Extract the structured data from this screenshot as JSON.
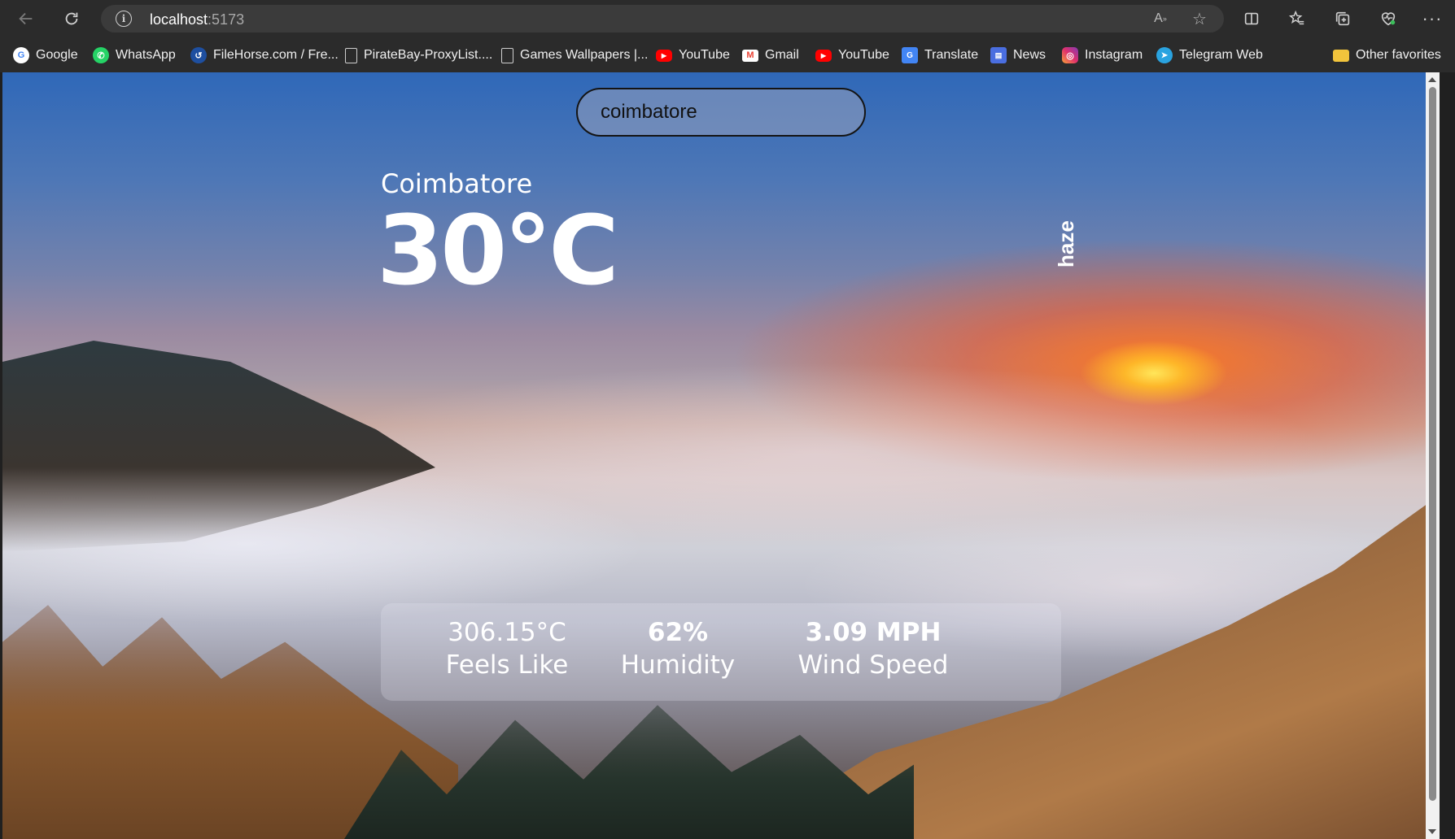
{
  "browser": {
    "url_host": "localhost",
    "url_port": ":5173",
    "bookmarks": [
      {
        "label": "Google",
        "icon": "google-icon",
        "color": "#4285f4"
      },
      {
        "label": "WhatsApp",
        "icon": "whatsapp-icon",
        "color": "#25d366"
      },
      {
        "label": "FileHorse.com / Fre...",
        "icon": "filehorse-icon",
        "color": "#1e88e5"
      },
      {
        "label": "PirateBay-ProxyList....",
        "icon": "page-icon",
        "color": "#cfcfcf"
      },
      {
        "label": "Games Wallpapers |...",
        "icon": "page-icon",
        "color": "#cfcfcf"
      },
      {
        "label": "YouTube",
        "icon": "youtube-icon",
        "color": "#ff0000"
      },
      {
        "label": "Gmail",
        "icon": "gmail-icon",
        "color": "#ea4335"
      },
      {
        "label": "YouTube",
        "icon": "youtube-icon",
        "color": "#ff0000"
      },
      {
        "label": "Translate",
        "icon": "translate-icon",
        "color": "#4285f4"
      },
      {
        "label": "News",
        "icon": "news-icon",
        "color": "#4a6ee0"
      },
      {
        "label": "Instagram",
        "icon": "instagram-icon",
        "color": "#e1306c"
      },
      {
        "label": "Telegram Web",
        "icon": "telegram-icon",
        "color": "#2aa3e0"
      }
    ],
    "other_favorites": "Other favorites"
  },
  "weather": {
    "search_value": "coimbatore",
    "city": "Coimbatore",
    "temperature": "30°C",
    "description": "haze",
    "feels_like_value": "306.15°C",
    "feels_like_label": "Feels Like",
    "humidity_value": "62%",
    "humidity_label": "Humidity",
    "wind_value": "3.09 MPH",
    "wind_label": "Wind Speed"
  }
}
